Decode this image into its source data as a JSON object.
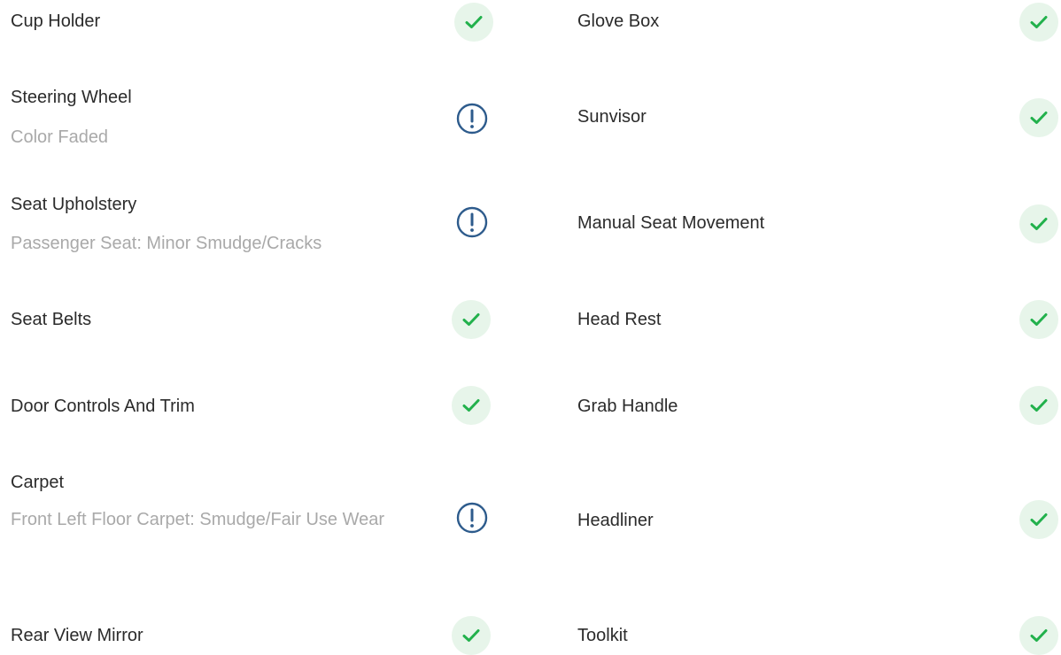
{
  "colors": {
    "ok": "#22b14c",
    "ok_bg": "#e7f5ea",
    "warn": "#2d5b8c",
    "text": "#2b2b2b",
    "muted": "#a9a9a9"
  },
  "left": [
    {
      "name": "Cup Holder",
      "status": "ok"
    },
    {
      "name": "Steering Wheel",
      "note": "Color Faded",
      "status": "warn"
    },
    {
      "name": "Seat Upholstery",
      "note": "Passenger Seat: Minor Smudge/Cracks",
      "status": "warn"
    },
    {
      "name": "Seat Belts",
      "status": "ok"
    },
    {
      "name": "Door Controls And Trim",
      "status": "ok"
    },
    {
      "name": "Carpet",
      "note": "Front Left Floor Carpet: Smudge/Fair Use Wear",
      "status": "warn"
    },
    {
      "name": "Rear View Mirror",
      "status": "ok"
    }
  ],
  "right": [
    {
      "name": "Glove Box",
      "status": "ok"
    },
    {
      "name": "Sunvisor",
      "status": "ok"
    },
    {
      "name": "Manual Seat Movement",
      "status": "ok"
    },
    {
      "name": "Head Rest",
      "status": "ok"
    },
    {
      "name": "Grab Handle",
      "status": "ok"
    },
    {
      "name": "Headliner",
      "status": "ok"
    },
    {
      "name": "Toolkit",
      "status": "ok"
    }
  ]
}
